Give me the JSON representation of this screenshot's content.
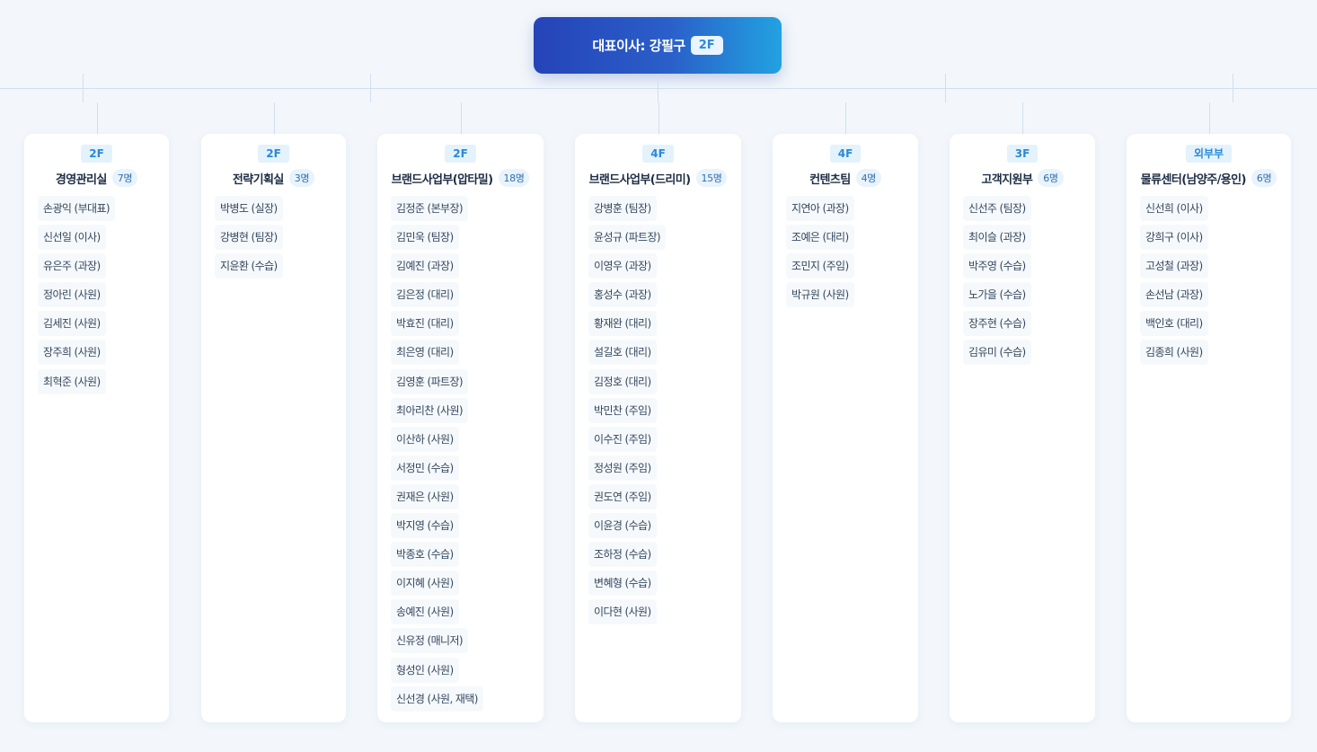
{
  "ceo": {
    "label": "대표이사: 강필구",
    "floor": "2F"
  },
  "departments": [
    {
      "floor": "2F",
      "name": "경영관리실",
      "count": "7명",
      "members": [
        "손광익 (부대표)",
        "신선일 (이사)",
        "유은주 (과장)",
        "정아린 (사원)",
        "김세진 (사원)",
        "장주희 (사원)",
        "최혁준 (사원)"
      ]
    },
    {
      "floor": "2F",
      "name": "전략기획실",
      "count": "3명",
      "members": [
        "박병도 (실장)",
        "강병현 (팀장)",
        "지윤환 (수습)"
      ]
    },
    {
      "floor": "2F",
      "name": "브랜드사업부(압타밀)",
      "count": "18명",
      "members": [
        "김정준 (본부장)",
        "김민욱 (팀장)",
        "김예진 (과장)",
        "김은정 (대리)",
        "박효진 (대리)",
        "최은영 (대리)",
        "김영훈 (파트장)",
        "최아리찬 (사원)",
        "이산하 (사원)",
        "서정민 (수습)",
        "권재은 (사원)",
        "박지영 (수습)",
        "박종호 (수습)",
        "이지혜 (사원)",
        "송예진 (사원)",
        "신유정 (매니저)",
        "형성인 (사원)",
        "신선경 (사원, 재택)"
      ]
    },
    {
      "floor": "4F",
      "name": "브랜드사업부(드리미)",
      "count": "15명",
      "members": [
        "강병훈 (팀장)",
        "윤성규 (파트장)",
        "이영우 (과장)",
        "홍성수 (과장)",
        "황재완 (대리)",
        "설길호 (대리)",
        "김정호 (대리)",
        "박민찬 (주임)",
        "이수진 (주임)",
        "정성원 (주임)",
        "권도연 (주임)",
        "이윤경 (수습)",
        "조하정 (수습)",
        "변혜형 (수습)",
        "이다현 (사원)"
      ]
    },
    {
      "floor": "4F",
      "name": "컨텐츠팀",
      "count": "4명",
      "members": [
        "지연아 (과장)",
        "조예은 (대리)",
        "조민지 (주임)",
        "박규원 (사원)"
      ]
    },
    {
      "floor": "3F",
      "name": "고객지원부",
      "count": "6명",
      "members": [
        "신선주 (팀장)",
        "최이슬 (과장)",
        "박주영 (수습)",
        "노가을 (수습)",
        "장주현 (수습)",
        "김유미 (수습)"
      ]
    },
    {
      "floor": "외부부",
      "name": "물류센터(남양주/용인)",
      "count": "6명",
      "members": [
        "신선희 (이사)",
        "강희구 (이사)",
        "고성철 (과장)",
        "손선남 (과장)",
        "백인호 (대리)",
        "김종희 (사원)"
      ]
    }
  ]
}
